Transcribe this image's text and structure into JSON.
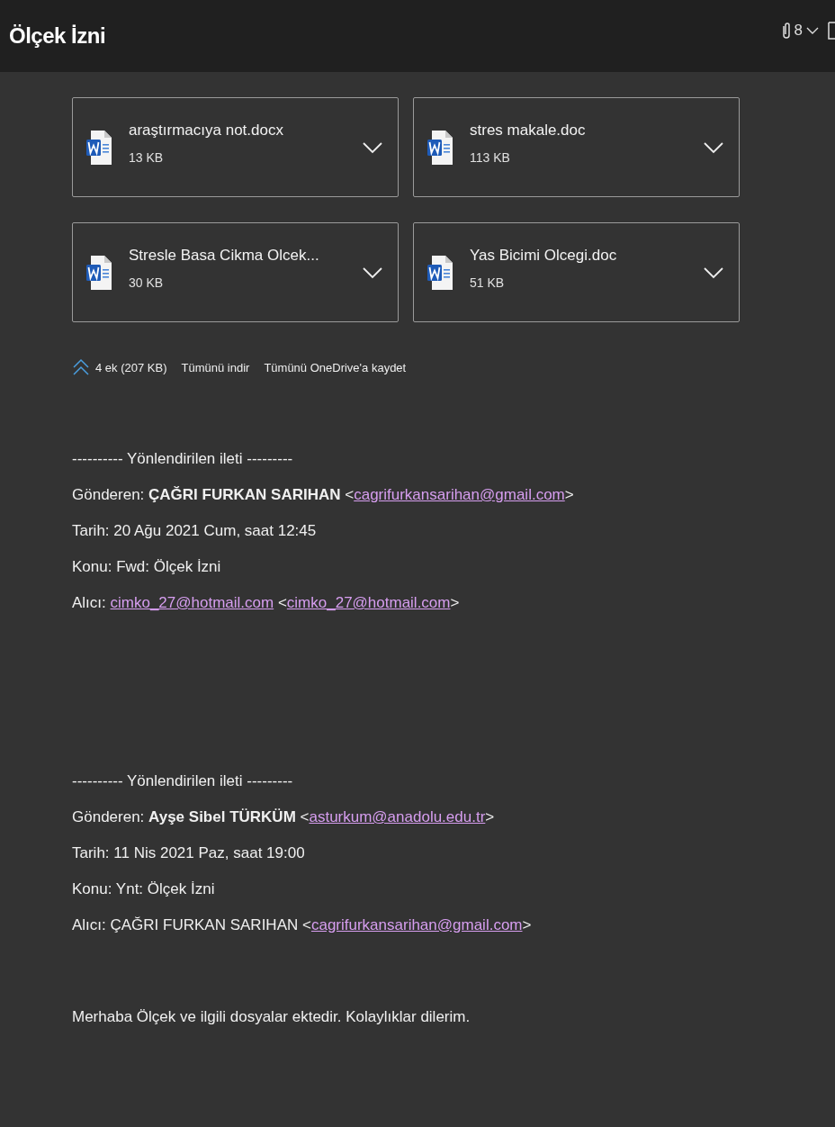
{
  "window": {
    "title": "Ölçek İzni",
    "attachment_count": "8"
  },
  "attachments": [
    {
      "name": "araştırmacıya not.docx",
      "size": "13 KB"
    },
    {
      "name": "stres makale.doc",
      "size": "113 KB"
    },
    {
      "name": "Stresle Basa Cikma Olcek...",
      "size": "30 KB"
    },
    {
      "name": "Yas Bicimi Olcegi.doc",
      "size": "51 KB"
    }
  ],
  "attachment_summary": {
    "count": "4 ek (207 KB)",
    "download_all": "Tümünü indir",
    "save_all": "Tümünü OneDrive'a kaydet"
  },
  "forwarded": [
    {
      "separator": "---------- Yönlendirilen ileti ---------",
      "lines": [
        [
          {
            "kind": "text",
            "text": "Gönderen: "
          },
          {
            "kind": "bold",
            "text": "ÇAĞRI FURKAN SARIHAN"
          },
          {
            "kind": "text",
            "text": " <"
          },
          {
            "kind": "link",
            "text": "cagrifurkansarihan@gmail.com"
          },
          {
            "kind": "text",
            "text": ">"
          }
        ],
        [
          {
            "kind": "text",
            "text": "Tarih: 20 Ağu 2021 Cum, saat 12:45"
          }
        ],
        [
          {
            "kind": "text",
            "text": "Konu: Fwd: Ölçek İzni"
          }
        ],
        [
          {
            "kind": "text",
            "text": "Alıcı: "
          },
          {
            "kind": "link",
            "text": "cimko_27@hotmail.com"
          },
          {
            "kind": "text",
            "text": " <"
          },
          {
            "kind": "link",
            "text": "cimko_27@hotmail.com"
          },
          {
            "kind": "text",
            "text": ">"
          }
        ]
      ]
    },
    {
      "separator": "---------- Yönlendirilen ileti ---------",
      "lines": [
        [
          {
            "kind": "text",
            "text": "Gönderen: "
          },
          {
            "kind": "bold",
            "text": "Ayşe Sibel TÜRKÜM"
          },
          {
            "kind": "text",
            "text": " <"
          },
          {
            "kind": "link",
            "text": "asturkum@anadolu.edu.tr"
          },
          {
            "kind": "text",
            "text": ">"
          }
        ],
        [
          {
            "kind": "text",
            "text": "Tarih: 11 Nis 2021 Paz, saat 19:00"
          }
        ],
        [
          {
            "kind": "text",
            "text": "Konu: Ynt: Ölçek İzni"
          }
        ],
        [
          {
            "kind": "text",
            "text": "Alıcı: ÇAĞRI FURKAN SARIHAN <"
          },
          {
            "kind": "link",
            "text": "cagrifurkansarihan@gmail.com"
          },
          {
            "kind": "text",
            "text": ">"
          }
        ]
      ]
    }
  ],
  "body": "Merhaba Ölçek ve ilgili dosyalar ektedir. Kolaylıklar dilerim."
}
